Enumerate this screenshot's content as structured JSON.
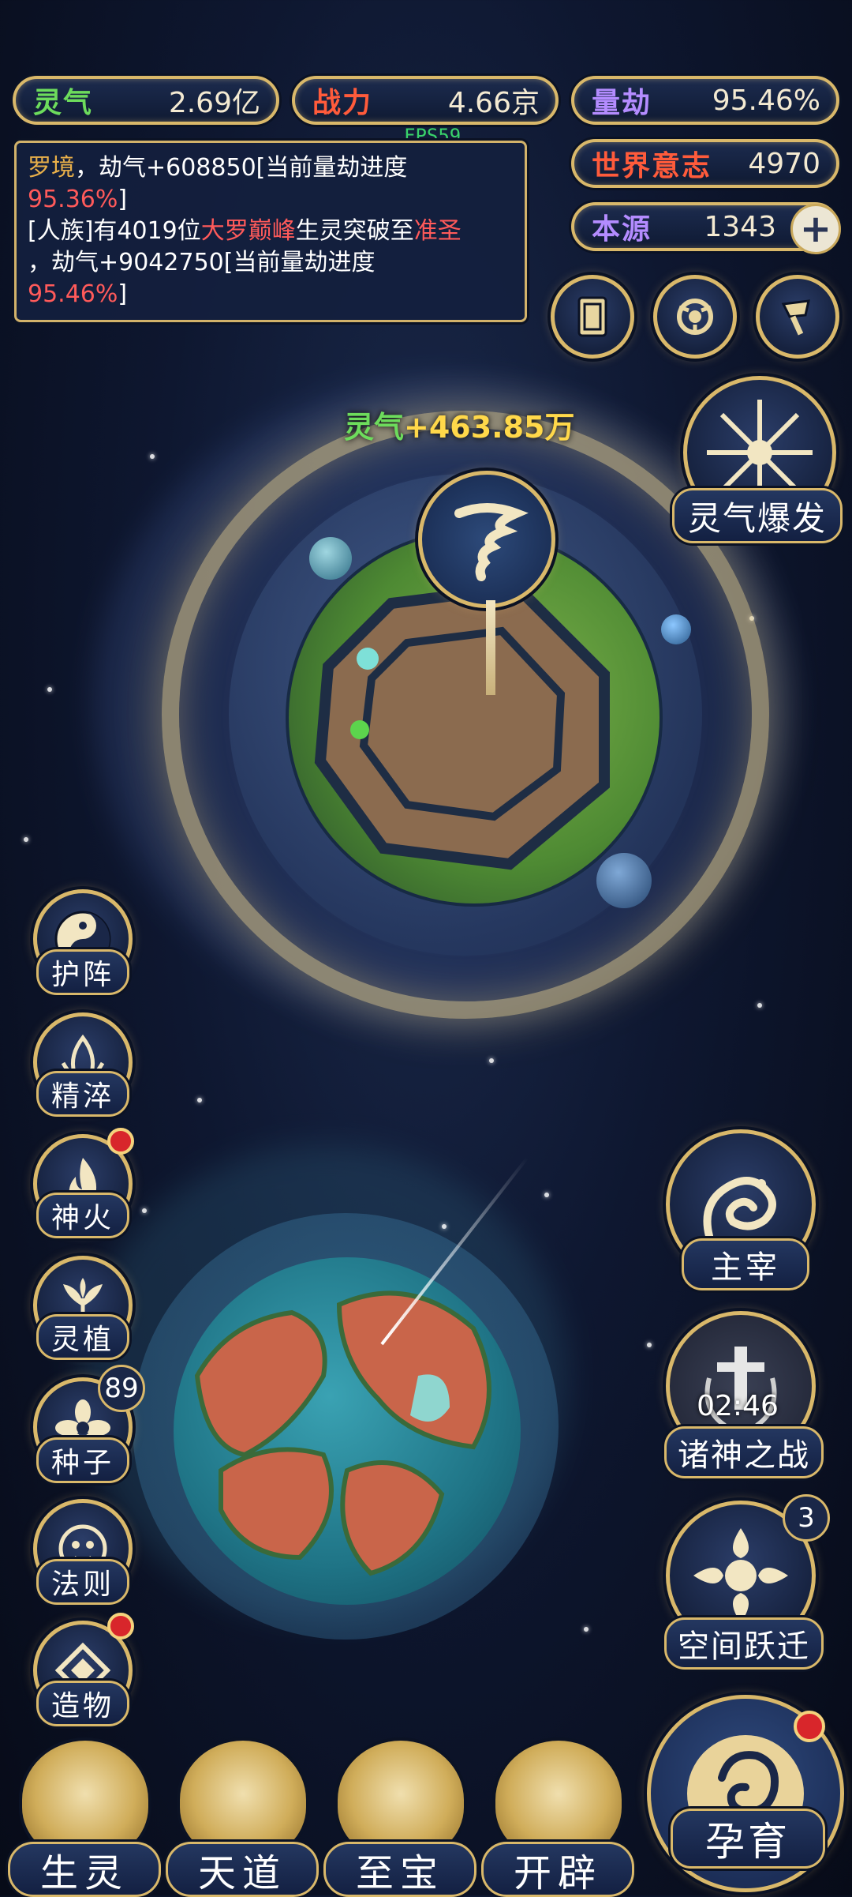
{
  "stats": {
    "lingqi": {
      "label": "灵气",
      "value": "2.69亿",
      "color": "#6ddc5c"
    },
    "zhanli": {
      "label": "战力",
      "value": "4.66京",
      "color": "#ff5b3b"
    },
    "liangjie": {
      "label": "量劫",
      "value": "95.46%",
      "color": "#b48cff"
    },
    "shijie": {
      "label": "世界意志",
      "value": "4970",
      "color": "#ff5b3b"
    },
    "benyuan": {
      "label": "本源",
      "value": "1343",
      "color": "#b48cff"
    }
  },
  "fps": "FPS59",
  "log": {
    "line1_a": "罗境",
    "line1_b": "，劫气+608850[当前量劫进度",
    "line1_c": "95.36%",
    "line1_d": "]",
    "line2_a": "[人族]有4019位",
    "line2_b": "大罗巅峰",
    "line2_c": "生灵突破至",
    "line2_d": "准圣",
    "line2_e": "，劫气+9042750[当前量劫进度",
    "line2_f": "95.46%",
    "line2_g": "]"
  },
  "floating": {
    "gain_label": "灵气",
    "gain_value": "+463.85万"
  },
  "right_buttons": {
    "burst": "灵气爆发",
    "zhuzai": "主宰",
    "battle": "诸神之战",
    "battle_timer": "02:46",
    "warp": "空间跃迁",
    "warp_badge": "3",
    "yunyu": "孕育"
  },
  "left_menu": [
    {
      "label": "护阵"
    },
    {
      "label": "精淬"
    },
    {
      "label": "神火"
    },
    {
      "label": "灵植"
    },
    {
      "label": "种子",
      "badge": "89"
    },
    {
      "label": "法则"
    },
    {
      "label": "造物"
    }
  ],
  "bottom_nav": [
    {
      "label": "生灵"
    },
    {
      "label": "天道"
    },
    {
      "label": "至宝"
    },
    {
      "label": "开辟"
    }
  ]
}
